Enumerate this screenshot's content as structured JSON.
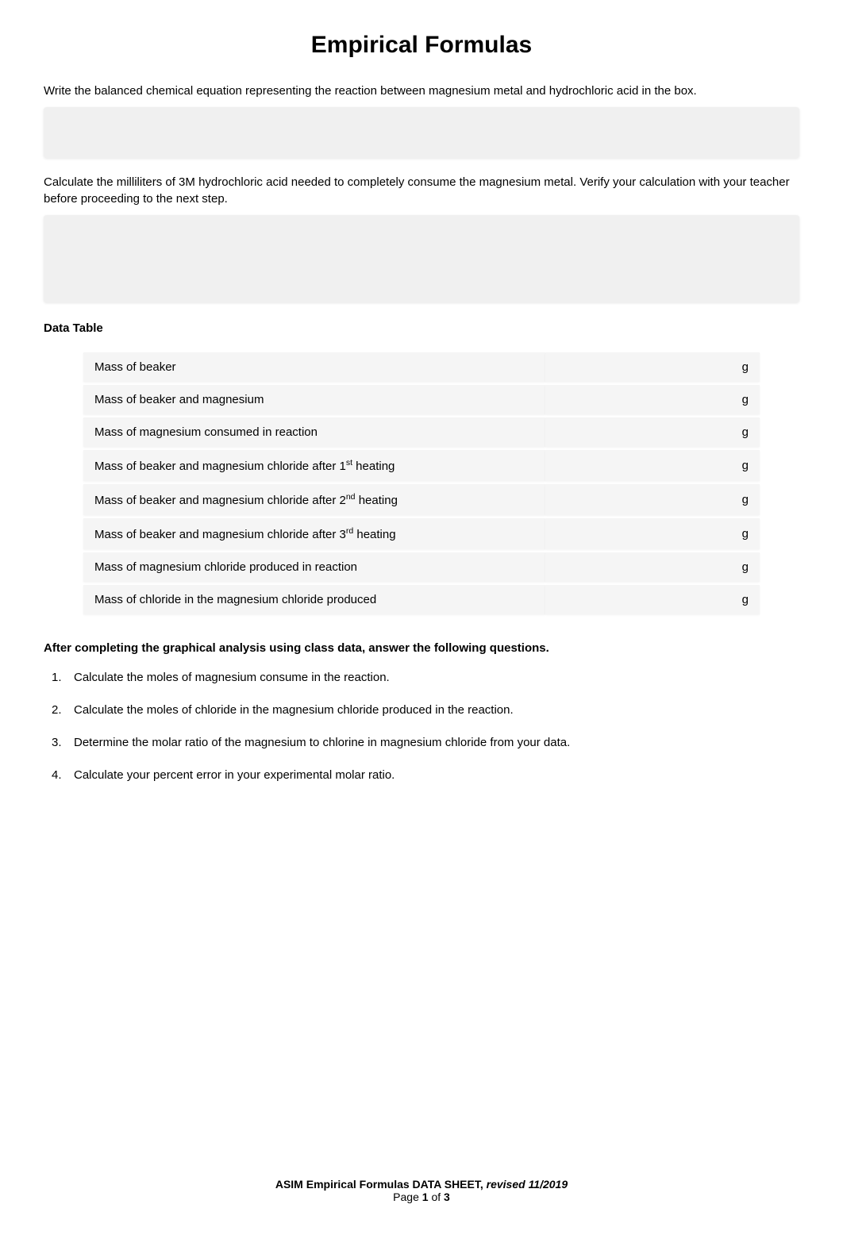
{
  "title": "Empirical Formulas",
  "para1": "Write the balanced chemical equation representing the reaction between magnesium metal and hydrochloric acid in the box.",
  "para2": "Calculate the milliliters of 3M hydrochloric acid needed to completely consume the magnesium metal.  Verify your calculation with your teacher before proceeding to the next step.",
  "data_table_heading": "Data Table",
  "table": {
    "rows": [
      {
        "label": "Mass of beaker",
        "unit": "g"
      },
      {
        "label": "Mass of beaker and magnesium",
        "unit": "g"
      },
      {
        "label": "Mass of magnesium consumed in reaction",
        "unit": "g"
      },
      {
        "label_pre": "Mass of beaker and magnesium chloride after 1",
        "sup": "st",
        "label_post": " heating",
        "unit": "g"
      },
      {
        "label_pre": "Mass of beaker and magnesium chloride after 2",
        "sup": "nd",
        "label_post": " heating",
        "unit": "g"
      },
      {
        "label_pre": "Mass of beaker and magnesium chloride after 3",
        "sup": "rd",
        "label_post": " heating",
        "unit": "g"
      },
      {
        "label": "Mass of magnesium chloride produced in reaction",
        "unit": "g"
      },
      {
        "label": "Mass of chloride in the magnesium chloride produced",
        "unit": "g"
      }
    ]
  },
  "questions_intro": "After completing the graphical analysis using class data, answer the following questions.",
  "questions": [
    {
      "num": "1.",
      "text": "Calculate the moles of magnesium consume in the reaction."
    },
    {
      "num": "2.",
      "text": "Calculate the moles of chloride in the magnesium chloride produced in the reaction."
    },
    {
      "num": "3.",
      "text": "Determine the molar ratio of the magnesium to chlorine in magnesium chloride from your data."
    },
    {
      "num": "4.",
      "text": "Calculate your percent error in your experimental molar ratio."
    }
  ],
  "footer": {
    "line1_main": "ASIM Empirical Formulas DATA SHEET, ",
    "line1_revised": "revised 11/2019",
    "line2_pre": "Page ",
    "line2_cur": "1",
    "line2_mid": " of ",
    "line2_total": "3"
  }
}
